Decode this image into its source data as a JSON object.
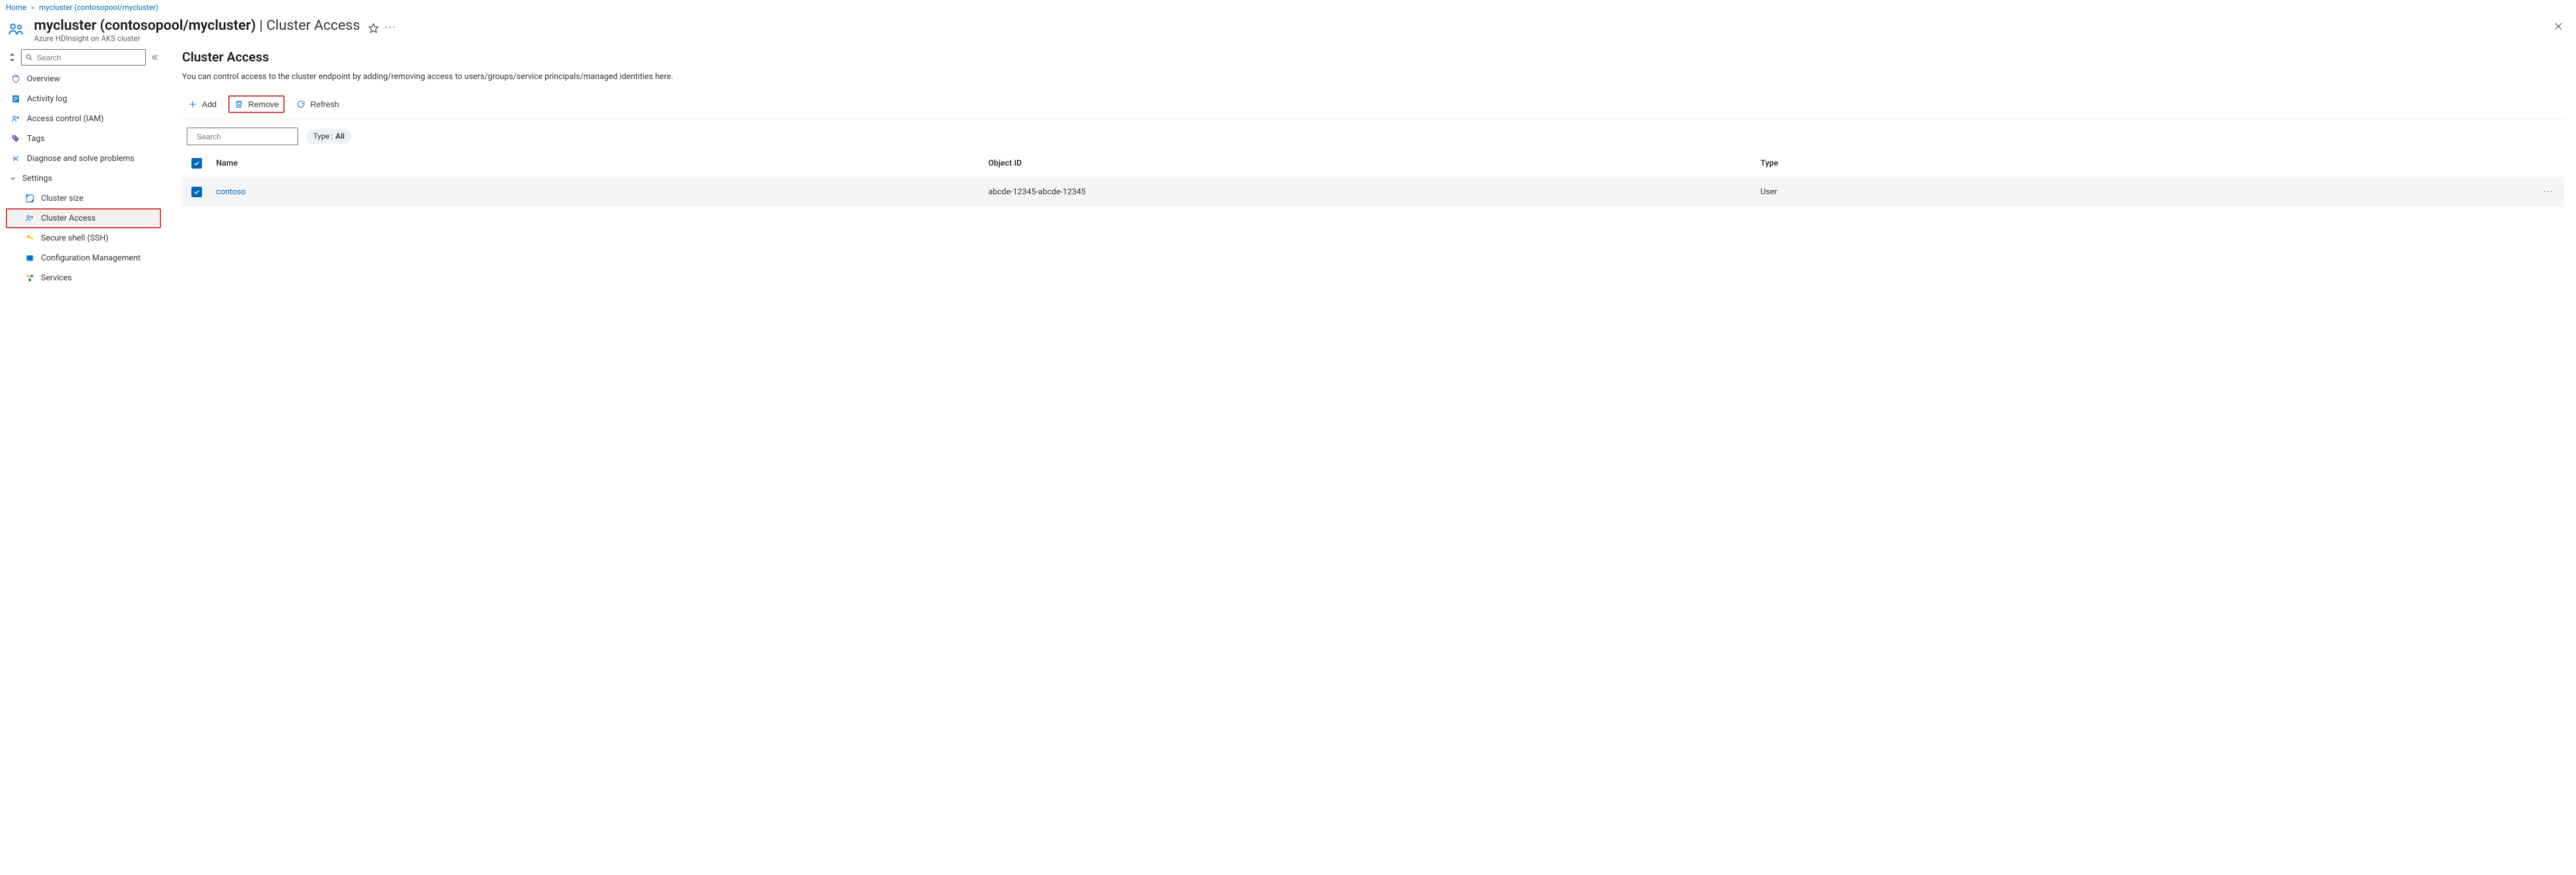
{
  "breadcrumb": {
    "home": "Home",
    "current": "mycluster (contosopool/mycluster)"
  },
  "header": {
    "title_main": "mycluster (contosopool/mycluster)",
    "title_separator": "|",
    "title_section": "Cluster Access",
    "subtitle": "Azure HDInsight on AKS cluster"
  },
  "sidebar": {
    "search_placeholder": "Search",
    "items": [
      {
        "id": "overview",
        "label": "Overview"
      },
      {
        "id": "activity-log",
        "label": "Activity log"
      },
      {
        "id": "access-control",
        "label": "Access control (IAM)"
      },
      {
        "id": "tags",
        "label": "Tags"
      },
      {
        "id": "diagnose",
        "label": "Diagnose and solve problems"
      }
    ],
    "group_settings": {
      "label": "Settings",
      "items": [
        {
          "id": "cluster-size",
          "label": "Cluster size"
        },
        {
          "id": "cluster-access",
          "label": "Cluster Access",
          "selected": true
        },
        {
          "id": "secure-shell",
          "label": "Secure shell (SSH)"
        },
        {
          "id": "config-mgmt",
          "label": "Configuration Management"
        },
        {
          "id": "services",
          "label": "Services"
        }
      ]
    }
  },
  "main": {
    "title": "Cluster Access",
    "description": "You can control access to the cluster endpoint by adding/removing access to users/groups/service principals/managed identities here.",
    "toolbar": {
      "add": "Add",
      "remove": "Remove",
      "refresh": "Refresh"
    },
    "filters": {
      "search_placeholder": "Search",
      "type_label": "Type :",
      "type_value": "All"
    },
    "table": {
      "columns": {
        "name": "Name",
        "object_id": "Object ID",
        "type": "Type"
      },
      "rows": [
        {
          "name": "contoso",
          "object_id": "abcde-12345-abcde-12345",
          "type": "User"
        }
      ]
    }
  }
}
